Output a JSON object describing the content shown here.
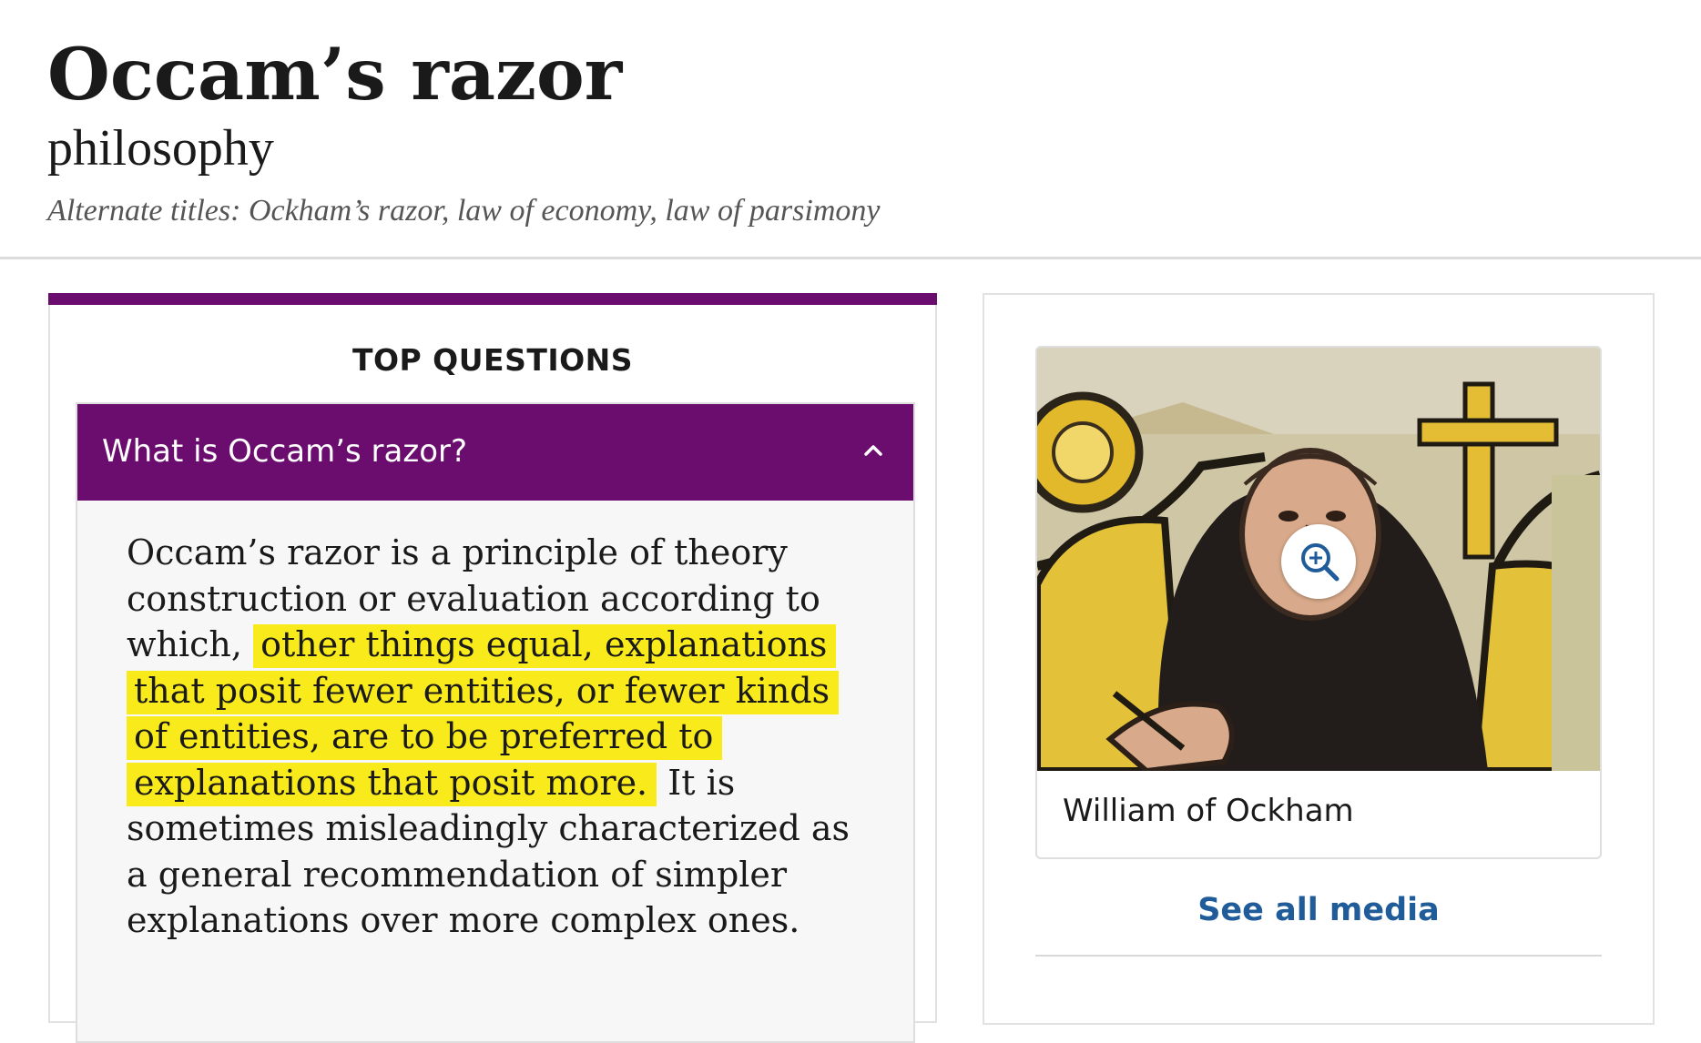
{
  "article": {
    "title": "Occam’s razor",
    "subtitle": "philosophy",
    "alternate_titles": "Alternate titles: Ockham’s razor, law of economy, law of parsimony"
  },
  "top_questions": {
    "heading": "TOP QUESTIONS",
    "items": [
      {
        "question": "What is Occam’s razor?",
        "expanded": true,
        "answer_before": "Occam’s razor is a principle of theory construction or evaluation according to which, ",
        "answer_highlight": "other things equal, explanations that posit fewer entities, or fewer kinds of entities, are to be preferred to explanations that posit more.",
        "answer_after": " It is sometimes misleadingly characterized as a general recommendation of simpler explanations over more complex ones."
      }
    ]
  },
  "media": {
    "caption": "William of Ockham",
    "see_all": "See all media"
  },
  "colors": {
    "accent_purple": "#6a0d6e",
    "link_blue": "#1f5c99",
    "highlight_yellow": "#f9ea1b"
  },
  "icons": [
    "chevron-up-icon",
    "zoom-in-icon"
  ]
}
